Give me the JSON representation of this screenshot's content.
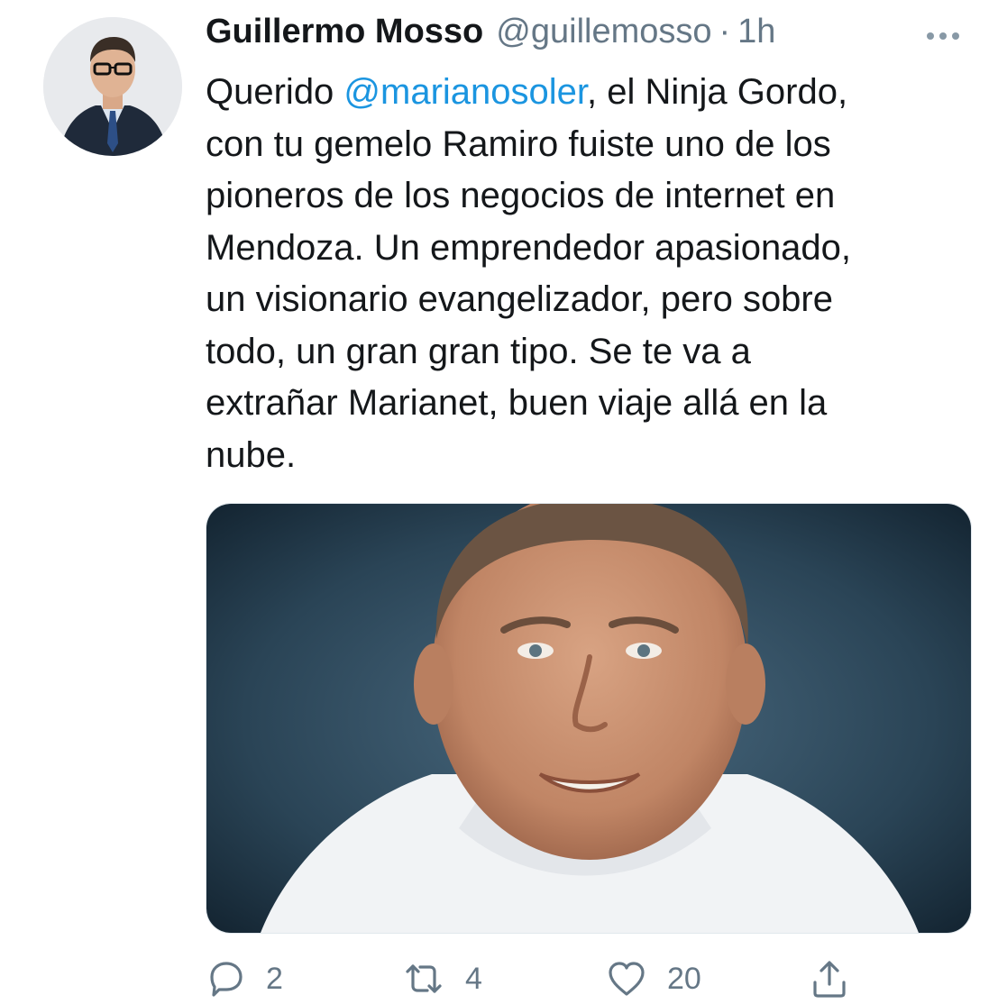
{
  "author": {
    "display_name": "Guillermo Mosso",
    "handle": "@guillemosso",
    "separator": "·",
    "time": "1h"
  },
  "tweet": {
    "lines": [
      {
        "before": "Querido ",
        "mention": "@marianosoler",
        "after": ", el Ninja Gordo,"
      },
      {
        "text": "con tu gemelo Ramiro fuiste uno de los"
      },
      {
        "text": "pioneros de los negocios de internet en"
      },
      {
        "text": "Mendoza. Un emprendedor apasionado,"
      },
      {
        "text": "un visionario evangelizador, pero sobre"
      },
      {
        "text": "todo, un gran gran tipo. Se te va a"
      },
      {
        "text": "extrañar Marianet, buen viaje allá en la"
      },
      {
        "text": "nube."
      }
    ]
  },
  "actions": {
    "reply_count": "2",
    "retweet_count": "4",
    "like_count": "20"
  },
  "icons": {
    "reply": "reply-icon",
    "retweet": "retweet-icon",
    "like": "heart-icon",
    "share": "share-icon",
    "more": "more-icon"
  },
  "colors": {
    "mention": "#1b95e0",
    "secondary_text": "#657786",
    "icon": "#657786"
  }
}
